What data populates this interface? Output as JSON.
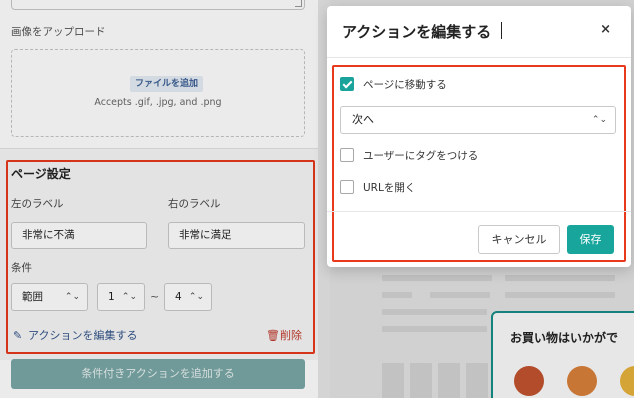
{
  "left_panel": {
    "upload_label": "画像をアップロード",
    "upload_button": "ファイルを追加",
    "upload_hint": "Accepts .gif, .jpg, and .png",
    "page_settings": {
      "title": "ページ設定",
      "left_label_caption": "左のラベル",
      "left_label_value": "非常に不満",
      "right_label_caption": "右のラベル",
      "right_label_value": "非常に満足",
      "condition_caption": "条件",
      "condition_operator": "範囲",
      "condition_from": "1",
      "condition_separator": "~",
      "condition_to": "4",
      "edit_action_link": "アクションを編集する",
      "delete_link": "削除"
    },
    "add_conditional_action_button": "条件付きアクションを追加する"
  },
  "modal": {
    "title": "アクションを編集する",
    "close_symbol": "×",
    "options": [
      {
        "label": "ページに移動する",
        "checked": true
      },
      {
        "label": "ユーザーにタグをつける",
        "checked": false
      },
      {
        "label": "URLを開く",
        "checked": false
      }
    ],
    "page_select_value": "次へ",
    "cancel_button": "キャンセル",
    "save_button": "保存"
  },
  "preview": {
    "survey_title": "お買い物はいかがで"
  },
  "icons": {
    "chevron": "chevron-up-down-icon",
    "edit": "pencil-icon",
    "delete": "trash-icon",
    "check": "checkmark-icon",
    "close": "close-icon"
  },
  "colors": {
    "accent_teal": "#17a59c",
    "highlight_red": "#e8391d",
    "link_blue": "#33558a",
    "delete_red": "#c0392b"
  }
}
